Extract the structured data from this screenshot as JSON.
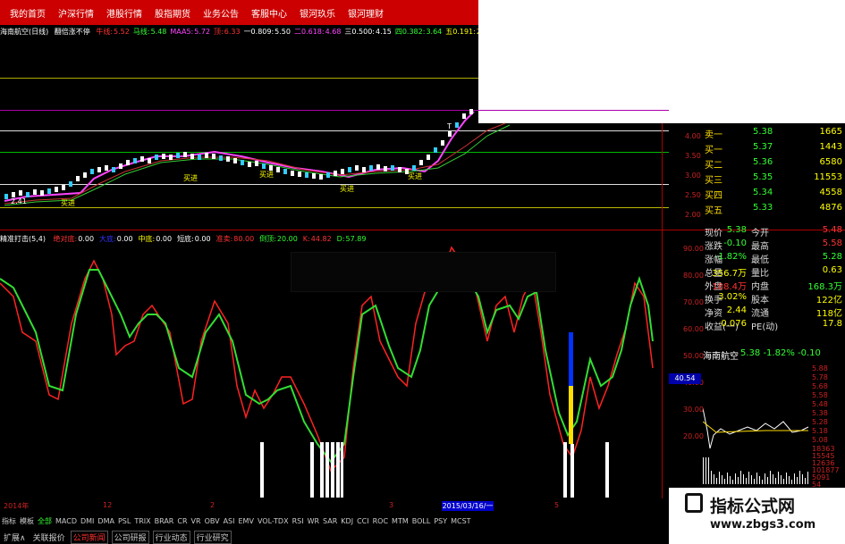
{
  "top_menu": [
    "我的首页",
    "沪深行情",
    "港股行情",
    "股指期货",
    "业务公告",
    "客服中心",
    "银河玖乐",
    "银河理财"
  ],
  "title_bar": {
    "stock": "海南航空(日线)",
    "sub": "翻倍涨不停",
    "items": [
      {
        "label": "牛线:",
        "value": "5.52",
        "color": "#ff3333"
      },
      {
        "label": "马线:",
        "value": "5.48",
        "color": "#33ff33"
      },
      {
        "label": "MAA5:",
        "value": "5.72",
        "color": "#ff44ff"
      },
      {
        "label": "顶:",
        "value": "6.33",
        "color": "#ff3333"
      },
      {
        "label": "一0.809:",
        "value": "5.50",
        "color": "#ffffff"
      },
      {
        "label": "二0.618:",
        "value": "4.68",
        "color": "#ff44ff"
      },
      {
        "label": "三0.500:",
        "value": "4.15",
        "color": "#ffffff"
      },
      {
        "label": "四0.382:",
        "value": "3.64",
        "color": "#33ff33"
      },
      {
        "label": "五0.191:",
        "value": "2.",
        "color": "#ffff00"
      }
    ]
  },
  "price_chart": {
    "low_label": "2.41",
    "buy_label": "买进",
    "t_label": "T",
    "y_ticks": [
      "4.00",
      "3.50",
      "3.00",
      "2.50",
      "2.00"
    ]
  },
  "quote_panel": {
    "orders": [
      {
        "label": "卖一",
        "price": "5.38",
        "vol": "1665"
      },
      {
        "label": "买一",
        "price": "5.37",
        "vol": "1443"
      },
      {
        "label": "买二",
        "price": "5.36",
        "vol": "6580"
      },
      {
        "label": "买三",
        "price": "5.35",
        "vol": "11553"
      },
      {
        "label": "买四",
        "price": "5.34",
        "vol": "4558"
      },
      {
        "label": "买五",
        "price": "5.33",
        "vol": "4876"
      }
    ],
    "stats": [
      {
        "l1": "现价",
        "v1": "5.38",
        "l2": "今开",
        "v2": "5.48",
        "c1": "#33ff33",
        "c2": "#ff3333"
      },
      {
        "l1": "涨跌",
        "v1": "-0.10",
        "l2": "最高",
        "v2": "5.58",
        "c1": "#33ff33",
        "c2": "#ff3333"
      },
      {
        "l1": "涨幅",
        "v1": "-1.82%",
        "l2": "最低",
        "v2": "5.28",
        "c1": "#33ff33",
        "c2": "#33ff33"
      },
      {
        "l1": "总量",
        "v1": "356.7万",
        "l2": "量比",
        "v2": "0.63",
        "c1": "#ffff00",
        "c2": "#ffff00"
      },
      {
        "l1": "外盘",
        "v1": "188.4万",
        "l2": "内盘",
        "v2": "168.3万",
        "c1": "#ff3333",
        "c2": "#33ff33"
      },
      {
        "l1": "换手",
        "v1": "3.02%",
        "l2": "股本",
        "v2": "122亿",
        "c1": "#ffff00",
        "c2": "#ffff00"
      },
      {
        "l1": "净资",
        "v1": "2.44",
        "l2": "流通",
        "v2": "118亿",
        "c1": "#ffff00",
        "c2": "#ffff00"
      },
      {
        "l1": "收益(一)",
        "v1": "0.076",
        "l2": "PE(动)",
        "v2": "17.8",
        "c1": "#ffff00",
        "c2": "#ffff00"
      }
    ],
    "mini_title": "海南航空",
    "mini_quote": "5.38 -1.82% -0.10",
    "mini_ticks": [
      "5.88",
      "5.78",
      "5.68",
      "5.58",
      "5.48",
      "5.38",
      "5.28",
      "5.18",
      "5.08"
    ],
    "mini_vol": [
      "18363",
      "15545",
      "12636",
      "101877",
      "5091",
      "54",
      "20"
    ]
  },
  "indicator": {
    "name": "精准打击(5,4)",
    "items": [
      {
        "label": "绝对底:",
        "value": "0.00",
        "color": "#ff3333"
      },
      {
        "label": "大底:",
        "value": "0.00",
        "color": "#3333ff"
      },
      {
        "label": "中底:",
        "value": "0.00",
        "color": "#ffff00"
      },
      {
        "label": "短底:",
        "value": "0.00",
        "color": "#ffffff"
      },
      {
        "label": "准卖:",
        "value": "80.00",
        "color": "#ff3333"
      },
      {
        "label": "倒顶:",
        "value": "20.00",
        "color": "#33ff33"
      },
      {
        "label": "K:",
        "value": "44.82",
        "color": "#ff3333"
      },
      {
        "label": "D:",
        "value": "57.89",
        "color": "#33ff33"
      }
    ],
    "y_ticks": [
      "90.00",
      "80.00",
      "70.00",
      "60.00",
      "50.00",
      "40.00",
      "30.00",
      "20.00",
      "10.00"
    ],
    "cursor_value": "40.54"
  },
  "date_axis": {
    "labels": [
      "2014年",
      "12",
      "2",
      "3",
      "4",
      "5"
    ],
    "cursor_date": "2015/03/16/一"
  },
  "bottom_tabs": [
    "指标",
    "模板",
    "全部",
    "MACD",
    "DMI",
    "DMA",
    "PSL",
    "TRIX",
    "BRAR",
    "CR",
    "VR",
    "OBV",
    "ASI",
    "EMV",
    "VOL-TDX",
    "RSI",
    "WR",
    "SAR",
    "KDJ",
    "CCI",
    "ROC",
    "MTM",
    "BOLL",
    "PSY",
    "MCST"
  ],
  "bottom_tabs2": [
    "扩展∧",
    "关联报价",
    "公司新闻",
    "公司研报",
    "行业动态",
    "行业研究"
  ],
  "watermark": {
    "title": "指标公式网",
    "url": "www.zbgs3.com"
  }
}
